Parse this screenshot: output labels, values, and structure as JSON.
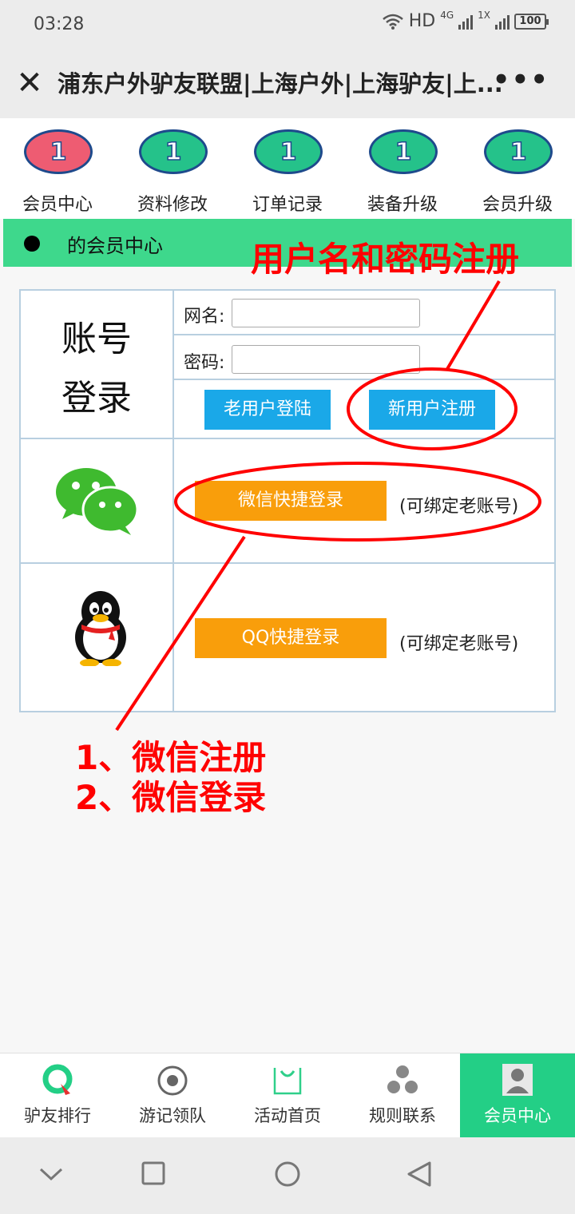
{
  "status_bar": {
    "time": "03:28",
    "network": "HD",
    "net_gen": "4G",
    "sim2": "1X",
    "battery": "100"
  },
  "title_bar": {
    "title": "浦东户外驴友联盟|上海户外|上海驴友|上..."
  },
  "top_nav": [
    {
      "label": "会员中心",
      "badge": "1",
      "badge_color": "#ee5c72"
    },
    {
      "label": "资料修改",
      "badge": "1",
      "badge_color": "#25c28a"
    },
    {
      "label": "订单记录",
      "badge": "1",
      "badge_color": "#25c28a"
    },
    {
      "label": "装备升级",
      "badge": "1",
      "badge_color": "#25c28a"
    },
    {
      "label": "会员升级",
      "badge": "1",
      "badge_color": "#25c28a"
    }
  ],
  "section_header": {
    "text": "的会员中心"
  },
  "annotations": {
    "register": "用户名和密码注册",
    "wechat_line1": "1、微信注册",
    "wechat_line2": "2、微信登录",
    "color": "#ff0000"
  },
  "login": {
    "heading_line1": "账号",
    "heading_line2": "登录",
    "username_label": "网名:",
    "username_value": "",
    "password_label": "密码:",
    "password_value": "",
    "old_user_button": "老用户登陆",
    "new_user_button": "新用户注册",
    "wechat_button": "微信快捷登录",
    "wechat_hint": "(可绑定老账号)",
    "qq_button": "QQ快捷登录",
    "qq_hint": "(可绑定老账号)"
  },
  "tab_bar": [
    {
      "label": "驴友排行",
      "icon": "ranking-icon",
      "active": false
    },
    {
      "label": "游记领队",
      "icon": "target-icon",
      "active": false
    },
    {
      "label": "活动首页",
      "icon": "home-smile-icon",
      "active": false
    },
    {
      "label": "规则联系",
      "icon": "dots-cluster-icon",
      "active": false
    },
    {
      "label": "会员中心",
      "icon": "user-icon",
      "active": true
    }
  ],
  "colors": {
    "accent_green": "#3ed88c",
    "tab_active": "#23cf86",
    "button_blue": "#1aa8e8",
    "button_orange": "#f99e0b"
  }
}
